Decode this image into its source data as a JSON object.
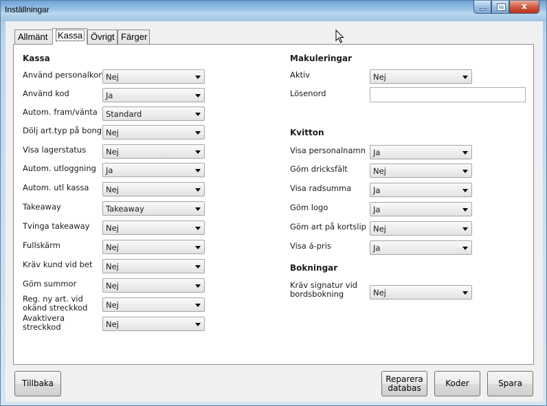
{
  "window": {
    "title": "Inställningar",
    "close_glyph": "x"
  },
  "tabs": [
    {
      "label": "Allmänt"
    },
    {
      "label": "Kassa"
    },
    {
      "label": "Övrigt"
    },
    {
      "label": "Färger"
    }
  ],
  "kassa": {
    "title": "Kassa",
    "fields": [
      {
        "label": "Använd personalkort",
        "value": "Nej"
      },
      {
        "label": "Använd kod",
        "value": "Ja"
      },
      {
        "label": "Autom. fram/vänta",
        "value": "Standard"
      },
      {
        "label": "Dölj art.typ på bong",
        "value": "Nej"
      },
      {
        "label": "Visa lagerstatus",
        "value": "Nej"
      },
      {
        "label": "Autom. utloggning",
        "value": "Ja"
      },
      {
        "label": "Autom. utl kassa",
        "value": "Nej"
      },
      {
        "label": "Takeaway",
        "value": "Takeaway"
      },
      {
        "label": "Tvinga takeaway",
        "value": "Nej"
      },
      {
        "label": "Fullskärm",
        "value": "Nej"
      },
      {
        "label": "Kräv kund vid bet",
        "value": "Nej"
      },
      {
        "label": "Göm summor",
        "value": "Nej"
      },
      {
        "label": "Reg. ny art. vid okänd streckkod",
        "value": "Nej"
      },
      {
        "label": "Avaktivera streckkod",
        "value": "Nej"
      }
    ]
  },
  "makuleringar": {
    "title": "Makuleringar",
    "aktiv_label": "Aktiv",
    "aktiv_value": "Nej",
    "losenord_label": "Lösenord",
    "losenord_value": ""
  },
  "kvitton": {
    "title": "Kvitton",
    "fields": [
      {
        "label": "Visa personalnamn",
        "value": "Ja"
      },
      {
        "label": "Göm dricksfält",
        "value": "Nej"
      },
      {
        "label": "Visa radsumma",
        "value": "Ja"
      },
      {
        "label": "Göm logo",
        "value": "Ja"
      },
      {
        "label": "Göm art på kortslip",
        "value": "Nej"
      },
      {
        "label": "Visa á-pris",
        "value": "Ja"
      }
    ]
  },
  "bokningar": {
    "title": "Bokningar",
    "label": "Kräv signatur vid bordsbokning",
    "value": "Nej"
  },
  "buttons": {
    "back": "Tillbaka",
    "repair": "Reparera databas",
    "codes": "Koder",
    "save": "Spara"
  }
}
